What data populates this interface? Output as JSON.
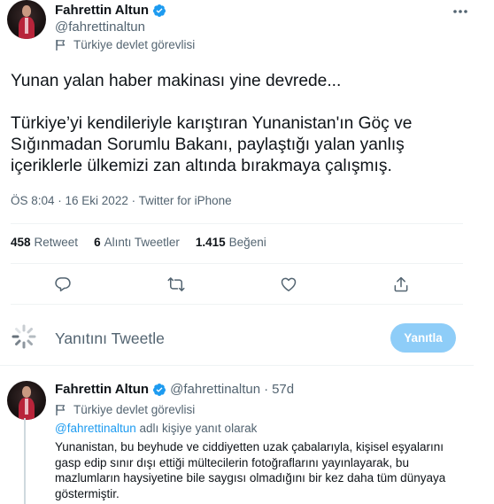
{
  "tweet": {
    "author_name": "Fahrettin Altun",
    "author_handle": "@fahrettinaltun",
    "affiliation": "Türkiye devlet görevlisi",
    "paragraph_1": "Yunan yalan haber makinası yine devrede...",
    "paragraph_2": "Türkiye’yi kendileriyle karıştıran Yunanistan'ın Göç ve Sığınmadan Sorumlu Bakanı, paylaştığı yalan yanlış içeriklerle ülkemizi zan altında bırakmaya çalışmış.",
    "meta": "ÖS 8:04 · 16 Eki 2022 · Twitter for iPhone",
    "stats": {
      "retweets_count": "458",
      "retweets_label": "Retweet",
      "quotes_count": "6",
      "quotes_label": "Alıntı Tweetler",
      "likes_count": "1.415",
      "likes_label": "Beğeni"
    }
  },
  "actions": {
    "reply_icon": "reply-icon",
    "retweet_icon": "retweet-icon",
    "like_icon": "heart-icon",
    "share_icon": "share-icon"
  },
  "reply_box": {
    "placeholder": "Yanıtını Tweetle",
    "button_label": "Yanıtla"
  },
  "reply": {
    "author_name": "Fahrettin Altun",
    "author_handle": "@fahrettinaltun",
    "separator": "·",
    "age": "57d",
    "affiliation": "Türkiye devlet görevlisi",
    "replying_mention": "@fahrettinaltun",
    "replying_suffix": " adlı kişiye yanıt olarak",
    "text": "Yunanistan, bu beyhude ve ciddiyetten uzak çabalarıyla, kişisel eşyalarını gasp edip sınır dışı ettiği mültecilerin fotoğraflarını yayınlayarak, bu mazlumların haysiyetine bile saygısı olmadığını bir kez daha tüm dünyaya göstermiştir."
  },
  "colors": {
    "accent": "#1d9bf0",
    "button_disabled": "#8ecdf8",
    "secondary_text": "#536471",
    "divider": "#eff3f4"
  }
}
